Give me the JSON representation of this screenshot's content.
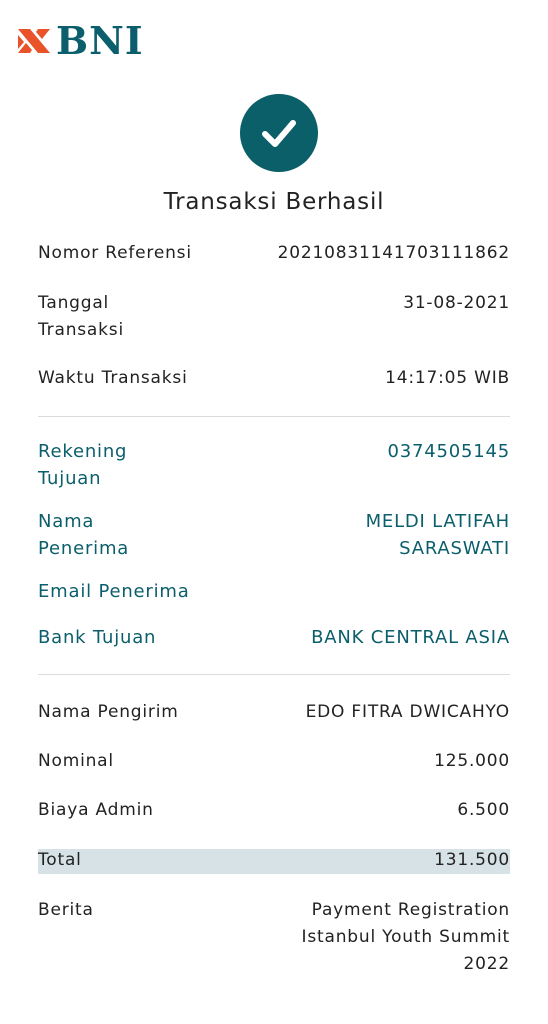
{
  "brand": {
    "name": "BNI",
    "accent": "#0b5e6b",
    "logo_color": "#e8532a"
  },
  "status": {
    "icon": "check-icon",
    "title": "Transaksi Berhasil"
  },
  "details": {
    "reference": {
      "label": "Nomor Referensi",
      "value": "20210831141703111862"
    },
    "date": {
      "label": "Tanggal Transaksi",
      "value": "31-08-2021"
    },
    "time": {
      "label": "Waktu Transaksi",
      "value": "14:17:05 WIB"
    }
  },
  "recipient": {
    "account": {
      "label": "Rekening Tujuan",
      "value": "0374505145"
    },
    "name": {
      "label": "Nama Penerima",
      "value": "MELDI LATIFAH SARASWATI"
    },
    "email": {
      "label": "Email Penerima",
      "value": ""
    },
    "bank": {
      "label": "Bank Tujuan",
      "value": "BANK CENTRAL ASIA"
    }
  },
  "summary": {
    "sender": {
      "label": "Nama Pengirim",
      "value": "EDO FITRA DWICAHYO"
    },
    "amount": {
      "label": "Nominal",
      "value": "125.000"
    },
    "fee": {
      "label": "Biaya Admin",
      "value": "6.500"
    },
    "total": {
      "label": "Total",
      "value": "131.500"
    },
    "note": {
      "label": "Berita",
      "value": "Payment Registration Istanbul Youth Summit 2022"
    }
  }
}
